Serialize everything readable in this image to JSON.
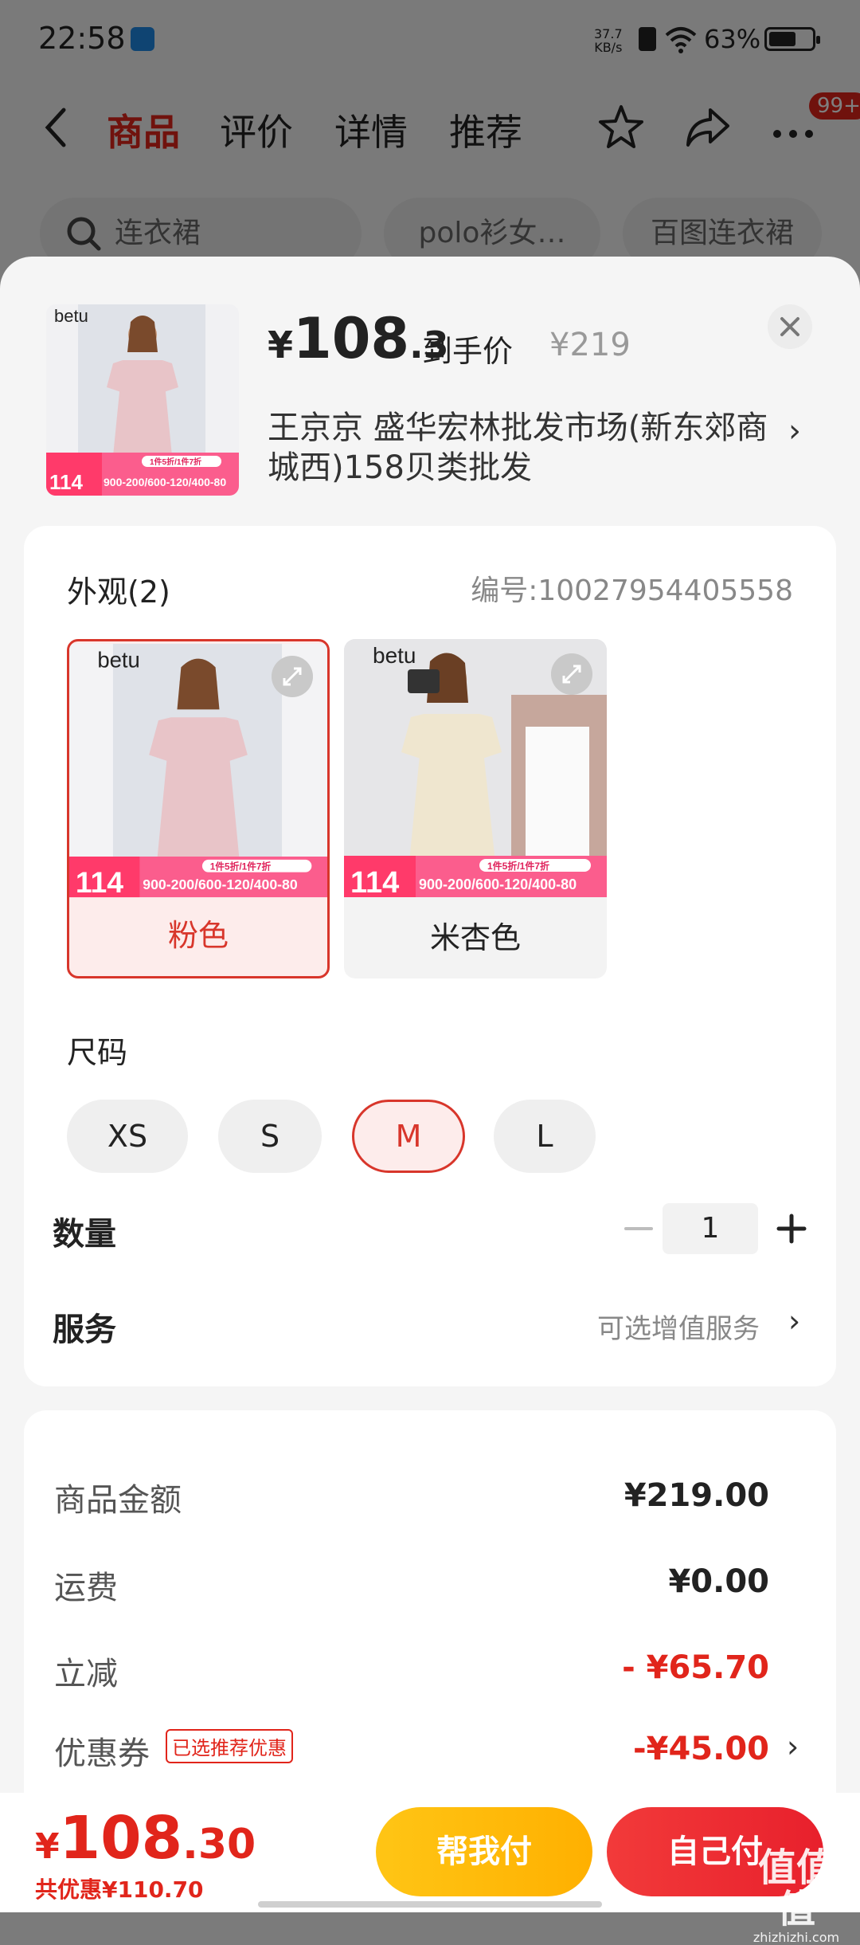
{
  "status": {
    "time": "22:58",
    "net_speed_value": "37.7",
    "net_speed_unit": "KB/s",
    "battery": "63%",
    "battery_level": 0.63
  },
  "nav": {
    "tabs": [
      "商品",
      "评价",
      "详情",
      "推荐"
    ],
    "active_tab": 0,
    "badge": "99+"
  },
  "search_chips": [
    "连衣裙",
    "polo衫女…",
    "百图连衣裙"
  ],
  "sheet": {
    "price_yen": "¥",
    "price_int": "108",
    "price_dec": ".3",
    "price_tag": "到手价",
    "orig_price": "¥219",
    "seller": "王京京  盛华宏林批发市场(新东郊商城西)158贝类批发",
    "promo": {
      "brand": "betu",
      "price": "114",
      "price_yen": "¥",
      "pill": "1件5折/1件7折",
      "range": "900-200/600-120/400-80"
    },
    "appearance": {
      "title": "外观(2)",
      "sku": "编号:10027954405558",
      "variants": [
        {
          "label": "粉色",
          "selected": true,
          "color": "#e8c4c8"
        },
        {
          "label": "米杏色",
          "selected": false,
          "color": "#efe6cf"
        }
      ]
    },
    "size": {
      "title": "尺码",
      "options": [
        "XS",
        "S",
        "M",
        "L"
      ],
      "selected": "M"
    },
    "quantity": {
      "label": "数量",
      "value": "1"
    },
    "service": {
      "label": "服务",
      "text": "可选增值服务"
    },
    "fees": {
      "goods_label": "商品金额",
      "goods_value": "¥219.00",
      "shipping_label": "运费",
      "shipping_value": "¥0.00",
      "discount_label": "立减",
      "discount_value": "- ¥65.70",
      "coupon_label": "优惠券",
      "coupon_tag": "已选推荐优惠",
      "coupon_value": "-¥45.00"
    }
  },
  "bottom": {
    "total_yen": "¥",
    "total_int": "108",
    "total_dec": ".30",
    "saving": "共优惠¥110.70",
    "help_pay": "帮我付",
    "self_pay": "自己付"
  },
  "watermark": {
    "big": "值值值",
    "small": "zhizhizhi.com"
  },
  "colors": {
    "brand_red": "#e1251b",
    "help_yellow": "#ffc515",
    "pink_dress": "#e8c4c8",
    "beige_dress": "#efe6cf"
  }
}
